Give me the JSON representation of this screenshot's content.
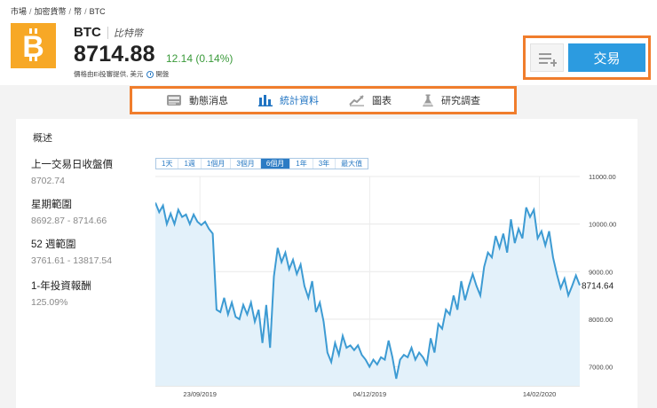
{
  "breadcrumb": [
    "市場",
    "加密貨幣",
    "幣",
    "BTC"
  ],
  "asset": {
    "symbol": "BTC",
    "name": "比特幣",
    "price": "8714.88",
    "change": "12.14 (0.14%)",
    "source": "價格由Ei投審提供, 美元",
    "market_status": "開盤",
    "logo_color": "#f7a826",
    "change_color": "#3a9a3a"
  },
  "actions": {
    "trade_label": "交易",
    "watchlist_icon": "add-to-list-icon",
    "accent": "#2c9be0"
  },
  "nav": [
    {
      "label": "動態消息",
      "icon": "news-icon",
      "active": false
    },
    {
      "label": "統計資料",
      "icon": "stats-bar-icon",
      "active": true
    },
    {
      "label": "圖表",
      "icon": "chart-icon",
      "active": false
    },
    {
      "label": "研究調查",
      "icon": "research-flask-icon",
      "active": false
    }
  ],
  "overview": {
    "title": "概述",
    "stats": [
      {
        "label": "上一交易日收盤價",
        "value": "8702.74"
      },
      {
        "label": "星期範圍",
        "value": "8692.87 - 8714.66"
      },
      {
        "label": "52 週範圍",
        "value": "3761.61 - 13817.54"
      },
      {
        "label": "1-年投資報酬",
        "value": "125.09%"
      }
    ]
  },
  "ranges": [
    {
      "label": "1天",
      "active": false
    },
    {
      "label": "1週",
      "active": false
    },
    {
      "label": "1個月",
      "active": false
    },
    {
      "label": "3個月",
      "active": false
    },
    {
      "label": "6個月",
      "active": true
    },
    {
      "label": "1年",
      "active": false
    },
    {
      "label": "3年",
      "active": false
    },
    {
      "label": "最大值",
      "active": false
    }
  ],
  "chart_data": {
    "type": "area",
    "x_tick_labels": [
      "23/09/2019",
      "04/12/2019",
      "14/02/2020"
    ],
    "y_tick_labels": [
      "11000.00",
      "10000.00",
      "9000.00",
      "8000.00",
      "7000.00"
    ],
    "ylim": [
      6600,
      11000
    ],
    "last_value_label": "8714.64",
    "line_color": "#3d9bd3",
    "fill_color": "#e3f1fa",
    "grid": true,
    "series": [
      {
        "values": [
          10450,
          10250,
          10390,
          10000,
          10220,
          10000,
          10300,
          10150,
          10200,
          10000,
          10200,
          10050,
          9980,
          10050,
          9900,
          9800,
          8200,
          8150,
          8450,
          8100,
          8350,
          8050,
          8000,
          8300,
          8100,
          8350,
          7950,
          8200,
          7500,
          8300,
          7400,
          8900,
          9500,
          9200,
          9400,
          9050,
          9250,
          8950,
          9150,
          8700,
          8450,
          8800,
          8150,
          8350,
          7950,
          7300,
          7100,
          7500,
          7250,
          7650,
          7400,
          7450,
          7350,
          7450,
          7250,
          7150,
          7000,
          7150,
          7050,
          7200,
          7150,
          7550,
          7200,
          6750,
          7150,
          7250,
          7200,
          7400,
          7150,
          7300,
          7200,
          7050,
          7600,
          7300,
          7900,
          7800,
          8200,
          8100,
          8500,
          8200,
          8800,
          8400,
          8700,
          8950,
          8700,
          8500,
          9100,
          9400,
          9300,
          9750,
          9500,
          9800,
          9400,
          10100,
          9600,
          9900,
          9700,
          10350,
          10150,
          10300,
          9700,
          9850,
          9550,
          9850,
          9300,
          8950,
          8650,
          8850,
          8500,
          8700,
          8920,
          8714.64
        ]
      }
    ]
  }
}
